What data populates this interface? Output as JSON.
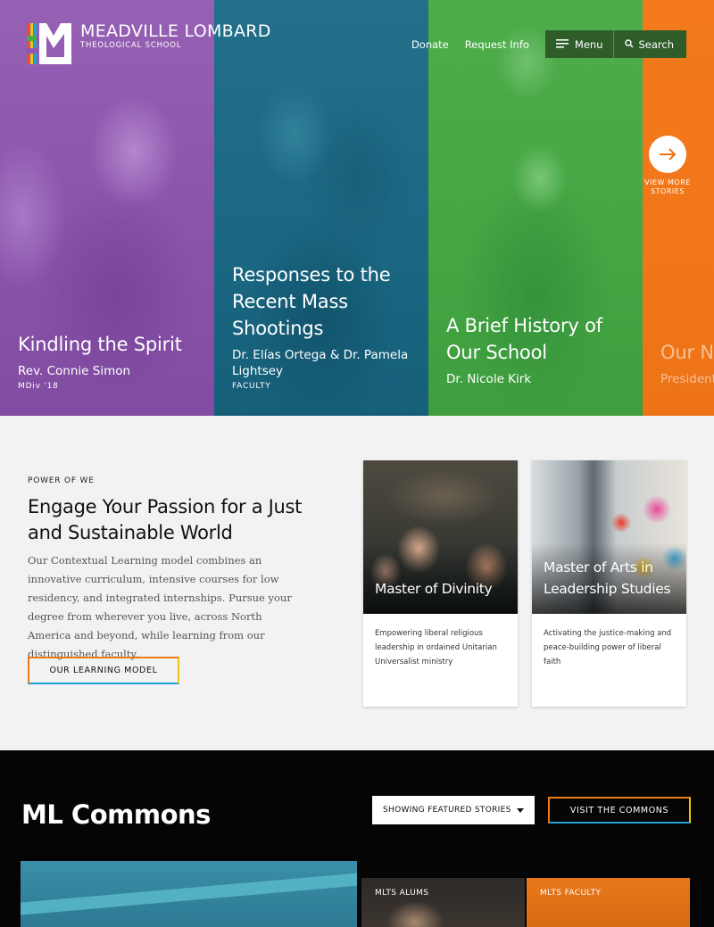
{
  "brand": {
    "name": "MEADVILLE LOMBARD",
    "subtitle": "THEOLOGICAL SCHOOL"
  },
  "nav": {
    "donate": "Donate",
    "request_info": "Request Info",
    "menu": "Menu",
    "search": "Search"
  },
  "hero": {
    "stories": [
      {
        "title": "Kindling the Spirit",
        "author": "Rev. Connie Simon",
        "role": "MDiv '18",
        "color": "#8e56b2"
      },
      {
        "title": "Responses to the Recent Mass Shootings",
        "author": "Dr. Elías Ortega & Dr. Pamela Lightsey",
        "role": "FACULTY",
        "color": "#166884"
      },
      {
        "title": "A Brief History of Our School",
        "author": "Dr. Nicole Kirk",
        "role": "",
        "color": "#46aa46"
      },
      {
        "title": "Our N",
        "author": "President S",
        "role": "",
        "color": "#f07814"
      }
    ],
    "view_more": "VIEW MORE STORIES"
  },
  "power_of_we": {
    "eyebrow": "POWER OF WE",
    "heading": "Engage Your Passion for a Just and Sustainable World",
    "body": "Our Contextual Learning model combines an innovative curriculum, intensive courses for low residency, and integrated internships. Pursue your degree from wherever you live, across North America and beyond, while learning from our distinguished faculty.",
    "button": "OUR LEARNING MODEL",
    "programs": [
      {
        "title": "Master of Divinity",
        "description": "Empowering liberal religious leadership in ordained Unitarian Universalist ministry"
      },
      {
        "title": "Master of Arts in Leadership Studies",
        "description": "Activating the justice-making and peace-building power of liberal faith"
      }
    ]
  },
  "commons": {
    "heading": "ML Commons",
    "filter_selected": "SHOWING FEATURED STORIES",
    "button": "VISIT THE COMMONS",
    "tiles": [
      {
        "tag": "MLTS ALUMS"
      },
      {
        "tag": "MLTS FACULTY"
      }
    ]
  },
  "colors": {
    "accent_orange": "#ea7a1a",
    "accent_yellow": "#f1c30f",
    "accent_blue": "#22a0d8",
    "menu_green": "#2e5d2a"
  }
}
